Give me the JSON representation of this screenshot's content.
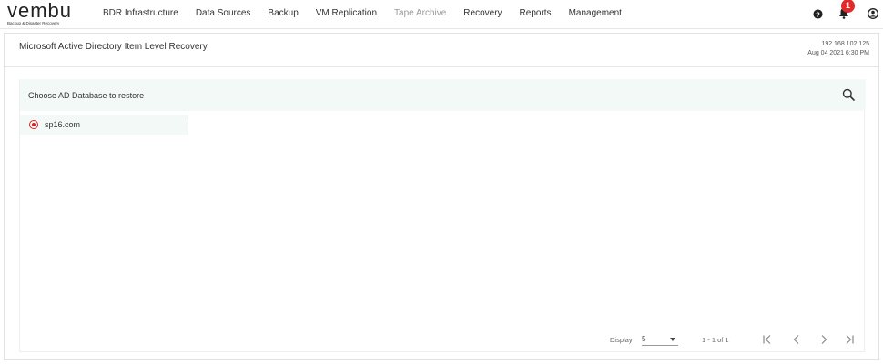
{
  "brand": {
    "logo_text": "vembu",
    "tagline": "Backup & Disaster Recovery"
  },
  "nav": {
    "items": [
      {
        "label": "BDR Infrastructure",
        "enabled": true
      },
      {
        "label": "Data Sources",
        "enabled": true
      },
      {
        "label": "Backup",
        "enabled": true
      },
      {
        "label": "VM Replication",
        "enabled": true
      },
      {
        "label": "Tape Archive",
        "enabled": false
      },
      {
        "label": "Recovery",
        "enabled": true
      },
      {
        "label": "Reports",
        "enabled": true
      },
      {
        "label": "Management",
        "enabled": true
      }
    ],
    "notification_count": "1",
    "icons": [
      "help-icon",
      "bell-icon",
      "user-icon"
    ]
  },
  "page": {
    "title": "Microsoft Active Directory Item Level Recovery",
    "server_ip": "192.168.102.125",
    "server_time": "Aug 04 2021 6:30 PM"
  },
  "card": {
    "header_label": "Choose AD Database to restore",
    "items": [
      {
        "label": "sp16.com",
        "selected": true
      }
    ]
  },
  "pager": {
    "display_label": "Display",
    "page_size": "5",
    "range": "1 - 1 of 1"
  },
  "colors": {
    "accent_red": "#e12b2b",
    "header_bg": "#f3f9f6"
  }
}
